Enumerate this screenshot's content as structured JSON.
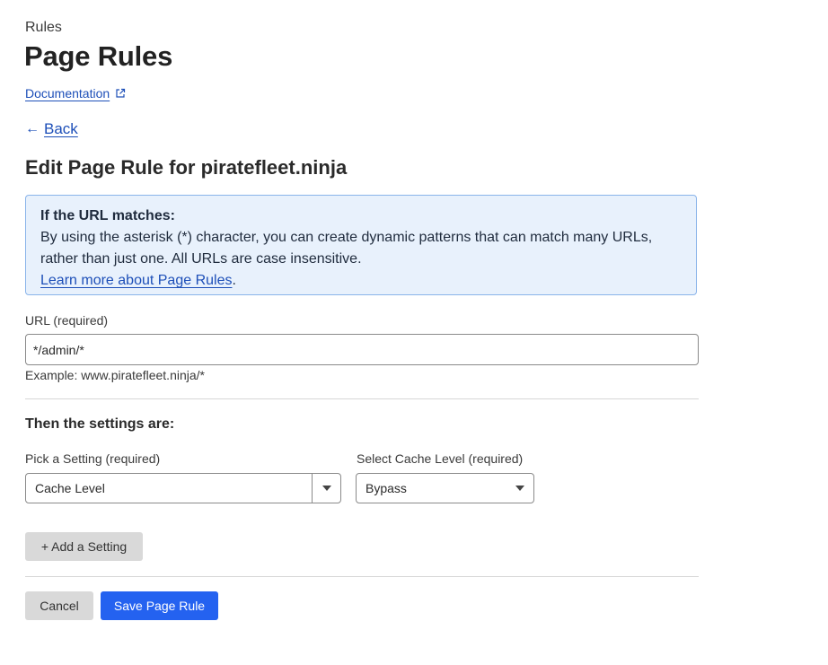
{
  "header": {
    "eyebrow": "Rules",
    "title": "Page Rules",
    "doc_link": "Documentation",
    "back_link": "Back",
    "section_title": "Edit Page Rule for piratefleet.ninja"
  },
  "info_box": {
    "title": "If the URL matches:",
    "body": "By using the asterisk (*) character, you can create dynamic patterns that can match many URLs, rather than just one. All URLs are case insensitive.",
    "link": "Learn more about Page Rules",
    "link_suffix": "."
  },
  "url_field": {
    "label": "URL (required)",
    "value": "*/admin/*",
    "help": "Example: www.piratefleet.ninja/*"
  },
  "settings": {
    "title": "Then the settings are:",
    "setting_label": "Pick a Setting (required)",
    "setting_value": "Cache Level",
    "cache_label": "Select Cache Level (required)",
    "cache_value": "Bypass"
  },
  "buttons": {
    "add_setting": "+ Add a Setting",
    "cancel": "Cancel",
    "save": "Save Page Rule"
  },
  "icons": {
    "external_link": "external-link-icon",
    "back_arrow": "arrow-left-icon",
    "dropdown": "chevron-down-icon"
  },
  "colors": {
    "link": "#1d4fb8",
    "primary_button": "#2462f0",
    "info_bg": "#e8f1fc",
    "info_border": "#8ab4ea"
  }
}
